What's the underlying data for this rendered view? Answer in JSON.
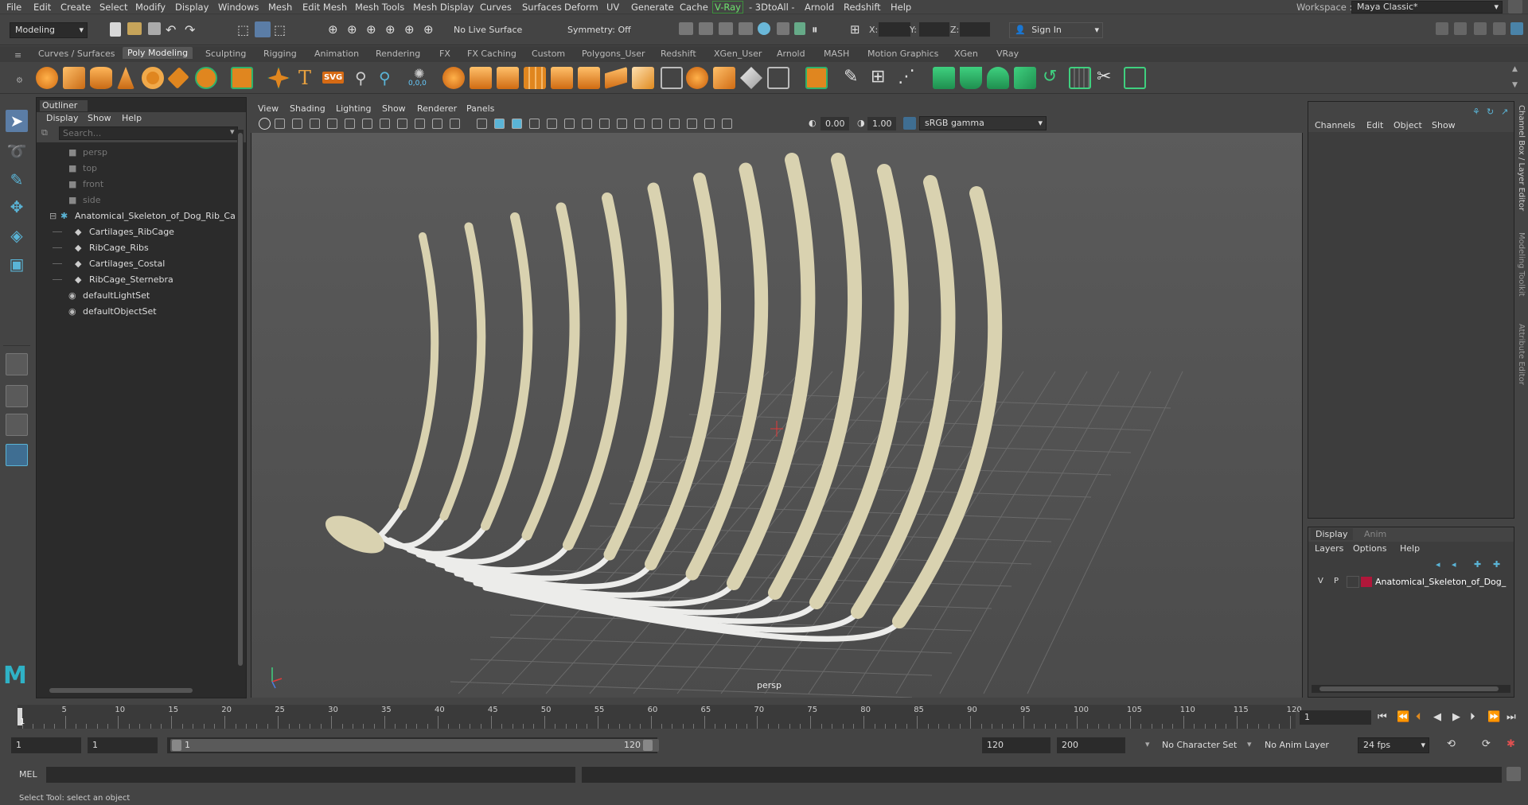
{
  "menubar": {
    "items": [
      "File",
      "Edit",
      "Create",
      "Select",
      "Modify",
      "Display",
      "Windows",
      "Mesh",
      "Edit Mesh",
      "Mesh Tools",
      "Mesh Display",
      "Curves",
      "Surfaces",
      "Deform",
      "UV",
      "Generate",
      "Cache",
      "V-Ray",
      "- 3DtoAll -",
      "Arnold",
      "Redshift",
      "Help"
    ],
    "workspace_label": "Workspace :",
    "workspace_value": "Maya Classic*"
  },
  "statusline": {
    "mode": "Modeling",
    "live_surface": "No Live Surface",
    "symmetry": "Symmetry: Off",
    "x_label": "X:",
    "y_label": "Y:",
    "z_label": "Z:",
    "sign_in": "Sign In"
  },
  "shelf": {
    "tabs": [
      "Curves / Surfaces",
      "Poly Modeling",
      "Sculpting",
      "Rigging",
      "Animation",
      "Rendering",
      "FX",
      "FX Caching",
      "Custom",
      "Polygons_User",
      "Redshift",
      "XGen_User",
      "Arnold",
      "MASH",
      "Motion Graphics",
      "XGen",
      "VRay"
    ],
    "active_tab": "Poly Modeling",
    "text_tool": "T",
    "svg_tool": "SVG",
    "coords_tool": "0,0,0"
  },
  "outliner": {
    "title": "Outliner",
    "menu": [
      "Display",
      "Show",
      "Help"
    ],
    "search_placeholder": "Search...",
    "items": [
      {
        "label": "persp",
        "dim": true,
        "indent": 1,
        "icon": "camera-icon"
      },
      {
        "label": "top",
        "dim": true,
        "indent": 1,
        "icon": "camera-icon"
      },
      {
        "label": "front",
        "dim": true,
        "indent": 1,
        "icon": "camera-icon"
      },
      {
        "label": "side",
        "dim": true,
        "indent": 1,
        "icon": "camera-icon"
      },
      {
        "label": "Anatomical_Skeleton_of_Dog_Rib_Ca",
        "dim": false,
        "indent": 0,
        "icon": "group-icon",
        "expanded": true
      },
      {
        "label": "Cartilages_RibCage",
        "dim": false,
        "indent": 2,
        "icon": "mesh-icon"
      },
      {
        "label": "RibCage_Ribs",
        "dim": false,
        "indent": 2,
        "icon": "mesh-icon"
      },
      {
        "label": "Cartilages_Costal",
        "dim": false,
        "indent": 2,
        "icon": "mesh-icon"
      },
      {
        "label": "RibCage_Sternebra",
        "dim": false,
        "indent": 2,
        "icon": "mesh-icon"
      },
      {
        "label": "defaultLightSet",
        "dim": false,
        "indent": 1,
        "icon": "set-icon"
      },
      {
        "label": "defaultObjectSet",
        "dim": false,
        "indent": 1,
        "icon": "set-icon"
      }
    ]
  },
  "viewport": {
    "menu": [
      "View",
      "Shading",
      "Lighting",
      "Show",
      "Renderer",
      "Panels"
    ],
    "exposure": "0.00",
    "gamma": "1.00",
    "colorspace": "sRGB gamma",
    "camera_label": "persp"
  },
  "channelbox": {
    "menu": [
      "Channels",
      "Edit",
      "Object",
      "Show"
    ],
    "side_tabs": [
      "Channel Box / Layer Editor",
      "Modeling Toolkit",
      "Attribute Editor"
    ]
  },
  "layereditor": {
    "tabs": [
      "Display",
      "Anim"
    ],
    "active_tab": "Display",
    "menu": [
      "Layers",
      "Options",
      "Help"
    ],
    "layer": {
      "v": "V",
      "p": "P",
      "name": "Anatomical_Skeleton_of_Dog_",
      "color": "#b0173a"
    }
  },
  "timeline": {
    "ticks": [
      "5",
      "10",
      "15",
      "20",
      "25",
      "30",
      "35",
      "40",
      "45",
      "50",
      "55",
      "60",
      "65",
      "70",
      "75",
      "80",
      "85",
      "90",
      "95",
      "100",
      "105",
      "110",
      "115",
      "120"
    ],
    "start_marker": "1",
    "current_frame": "1"
  },
  "range": {
    "start": "1",
    "playback_start": "1",
    "slider_start": "1",
    "slider_end": "120",
    "playback_end": "120",
    "end": "200",
    "character_set": "No Character Set",
    "anim_layer": "No Anim Layer",
    "fps": "24 fps"
  },
  "cmdline": {
    "label": "MEL"
  },
  "helpline": {
    "text": "Select Tool: select an object"
  },
  "colors": {
    "bone": "#d9d2b0",
    "cartilage": "#e8e8e6",
    "accent_green": "#2fb26b",
    "accent_orange": "#e08a1e"
  }
}
